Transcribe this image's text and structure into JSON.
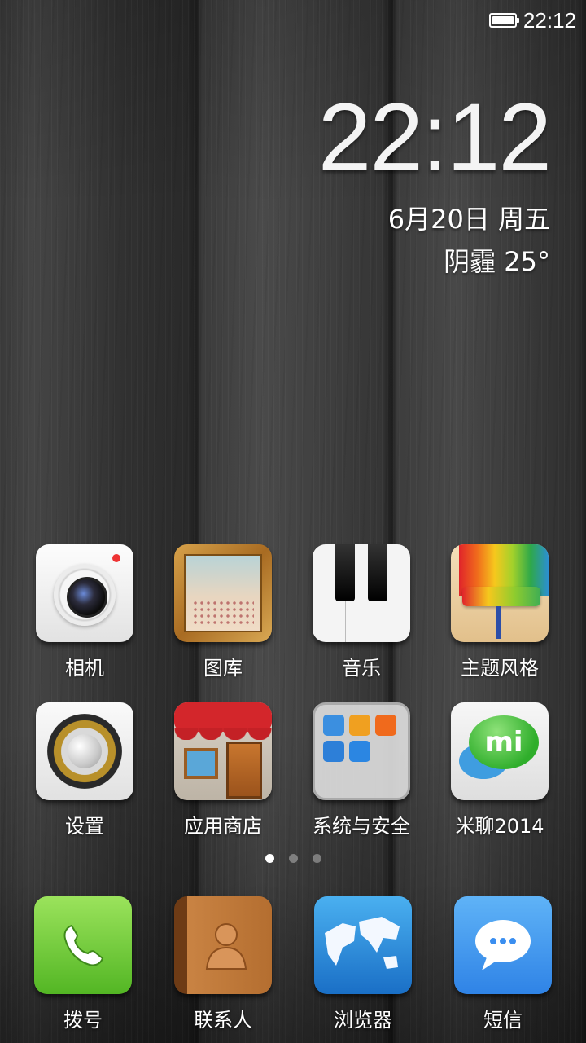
{
  "status_bar": {
    "time": "22:12",
    "battery_level": 1.0
  },
  "clock_widget": {
    "time": "22:12",
    "date": "6月20日 周五",
    "weather": "阴霾  25°"
  },
  "home_apps": [
    {
      "label": "相机",
      "icon": "camera-icon"
    },
    {
      "label": "图库",
      "icon": "gallery-icon"
    },
    {
      "label": "音乐",
      "icon": "music-icon"
    },
    {
      "label": "主题风格",
      "icon": "theme-icon"
    },
    {
      "label": "设置",
      "icon": "settings-icon"
    },
    {
      "label": "应用商店",
      "icon": "app-store-icon"
    },
    {
      "label": "系统与安全",
      "icon": "system-security-folder-icon"
    },
    {
      "label": "米聊2014",
      "icon": "mitalk-icon"
    }
  ],
  "page_indicator": {
    "pages": 3,
    "current": 1
  },
  "dock": [
    {
      "label": "拨号",
      "icon": "phone-icon"
    },
    {
      "label": "联系人",
      "icon": "contacts-icon"
    },
    {
      "label": "浏览器",
      "icon": "browser-icon"
    },
    {
      "label": "短信",
      "icon": "sms-icon"
    }
  ],
  "mitalk_badge_text": "mi"
}
